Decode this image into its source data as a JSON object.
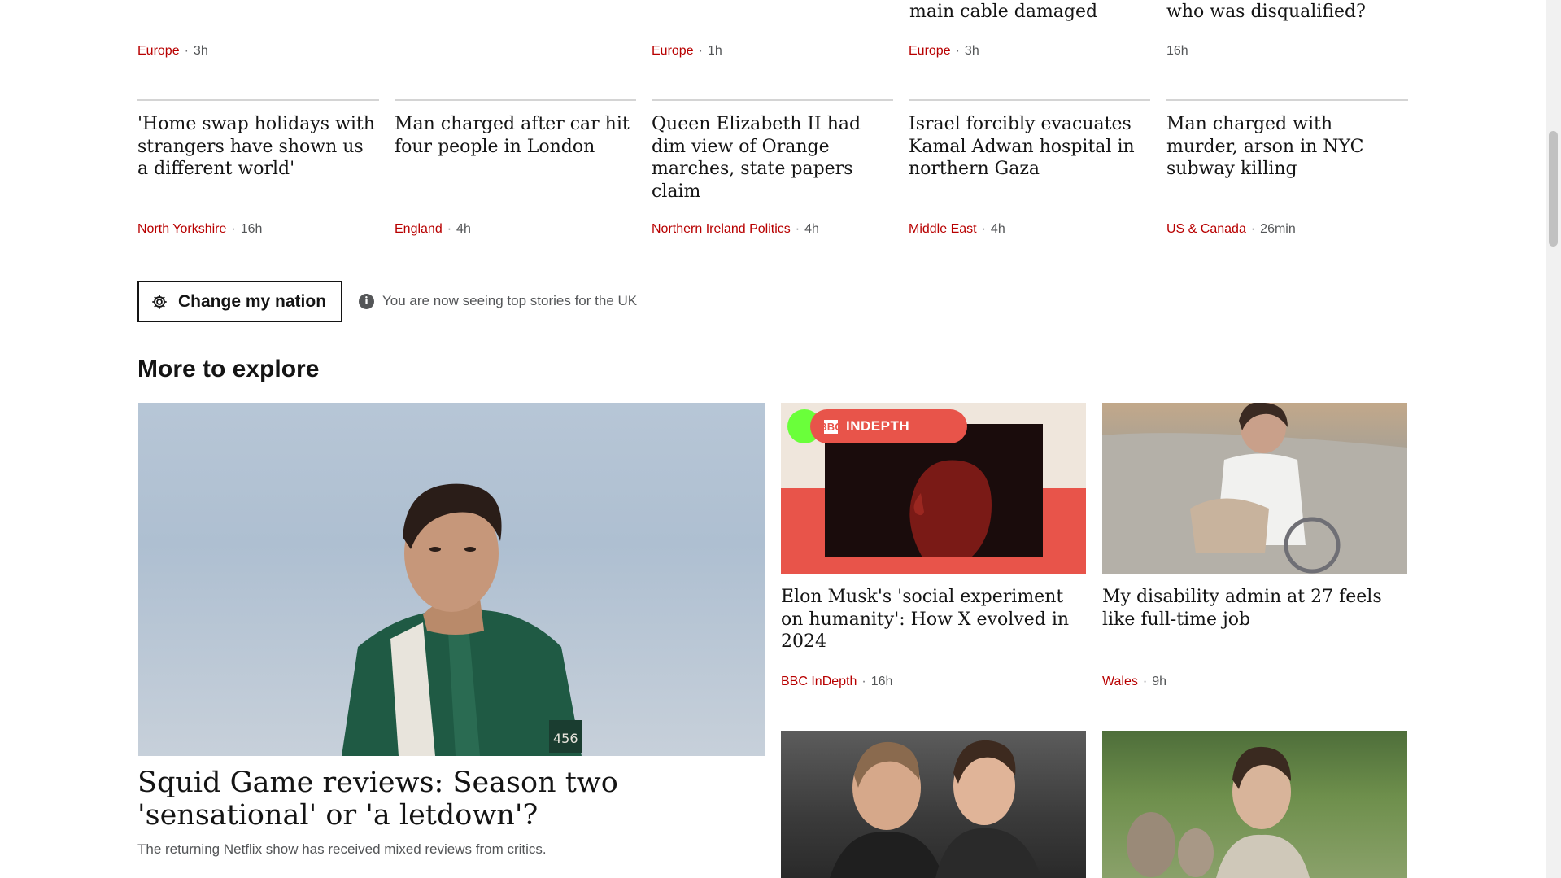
{
  "top_row": [
    {
      "title": "",
      "section": "Europe",
      "time": "3h"
    },
    {
      "title": "",
      "section": "",
      "time": ""
    },
    {
      "title": "",
      "section": "Europe",
      "time": "1h"
    },
    {
      "title": "main cable damaged",
      "section": "Europe",
      "time": "3h"
    },
    {
      "title": "who was disqualified?",
      "section": "",
      "time": "16h"
    }
  ],
  "stories": [
    {
      "title": "'Home swap holidays with strangers have shown us a different world'",
      "section": "North Yorkshire",
      "time": "16h"
    },
    {
      "title": "Man charged after car hit four people in London",
      "section": "England",
      "time": "4h"
    },
    {
      "title": "Queen Elizabeth II had dim view of Orange marches, state papers claim",
      "section": "Northern Ireland Politics",
      "time": "4h"
    },
    {
      "title": "Israel forcibly evacuates Kamal Adwan hospital in northern Gaza",
      "section": "Middle East",
      "time": "4h"
    },
    {
      "title": "Man charged with murder, arson in NYC subway killing",
      "section": "US & Canada",
      "time": "26min"
    }
  ],
  "nation": {
    "button_label": "Change my nation",
    "info_text": "You are now seeing top stories for the UK"
  },
  "explore": {
    "heading": "More to explore",
    "lead": {
      "title": "Squid Game reviews: Season two 'sensational' or 'a letdown'?",
      "summary": "The returning Netflix show has received mixed reviews from critics.",
      "jersey_number": "456"
    },
    "cards": [
      {
        "title": "Elon Musk's 'social experiment on humanity': How X evolved in 2024",
        "section": "BBC InDepth",
        "time": "16h",
        "badge_logo": "BBC",
        "badge_label": "INDEPTH"
      },
      {
        "title": "My disability admin at 27 feels like full-time job",
        "section": "Wales",
        "time": "9h"
      }
    ]
  },
  "colors": {
    "section_red": "#b80000",
    "text": "#141414",
    "meta_grey": "#545658"
  }
}
